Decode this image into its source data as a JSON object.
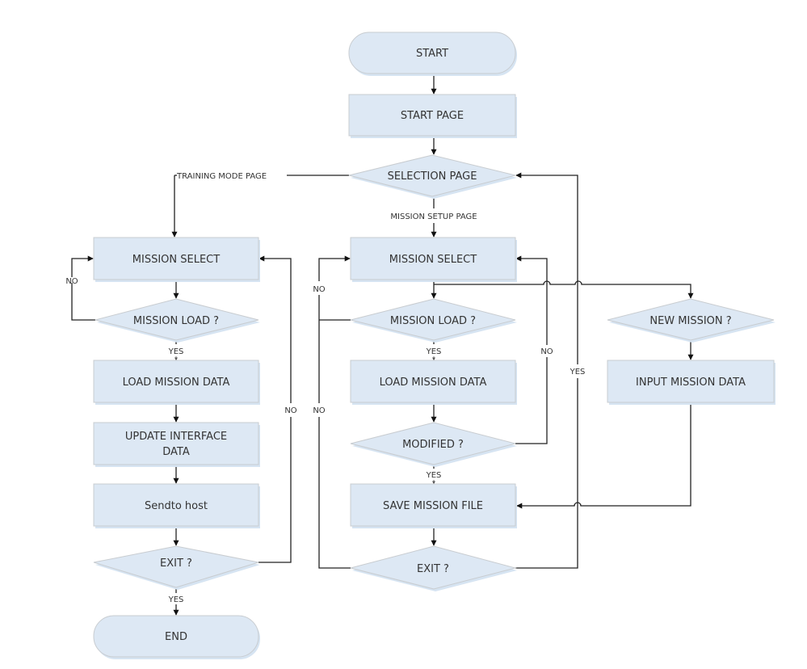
{
  "diagram": {
    "type": "flowchart",
    "colors": {
      "node_fill": "#dde8f4",
      "node_border": "#c8ccd0",
      "edge": "#222222",
      "text": "#333333"
    },
    "nodes": {
      "start": {
        "label": "START",
        "shape": "terminal"
      },
      "start_page": {
        "label": "START PAGE",
        "shape": "process"
      },
      "selection_page": {
        "label": "SELECTION PAGE",
        "shape": "decision"
      },
      "t_mission_select": {
        "label": "MISSION SELECT",
        "shape": "process"
      },
      "t_mission_load": {
        "label": "MISSION LOAD ?",
        "shape": "decision"
      },
      "t_load_data": {
        "label": "LOAD MISSION DATA",
        "shape": "process"
      },
      "t_update_line1": {
        "label": "UPDATE INTERFACE",
        "shape": "process"
      },
      "t_update_line2": {
        "label": "DATA",
        "shape": "process"
      },
      "t_sendto": {
        "label": "Sendto host",
        "shape": "process"
      },
      "t_exit": {
        "label": "EXIT ?",
        "shape": "decision"
      },
      "end": {
        "label": "END",
        "shape": "terminal"
      },
      "s_mission_select": {
        "label": "MISSION SELECT",
        "shape": "process"
      },
      "s_mission_load": {
        "label": "MISSION LOAD ?",
        "shape": "decision"
      },
      "s_load_data": {
        "label": "LOAD MISSION DATA",
        "shape": "process"
      },
      "s_modified": {
        "label": "MODIFIED ?",
        "shape": "decision"
      },
      "s_save": {
        "label": "SAVE MISSION FILE",
        "shape": "process"
      },
      "s_exit": {
        "label": "EXIT ?",
        "shape": "decision"
      },
      "new_mission": {
        "label": "NEW MISSION ?",
        "shape": "decision"
      },
      "input_data": {
        "label": "INPUT MISSION DATA",
        "shape": "process"
      }
    },
    "edge_labels": {
      "training_mode": "TRAINING MODE PAGE",
      "mission_setup": "MISSION SETUP PAGE",
      "t_load_no": "NO",
      "t_load_yes": "YES",
      "t_exit_no": "NO",
      "t_exit_yes": "YES",
      "s_load_no": "NO",
      "s_load_yes": "YES",
      "s_modified_no": "NO",
      "s_modified_yes": "YES",
      "s_exit_no": "NO",
      "s_exit_yes": "YES"
    },
    "edges": [
      {
        "from": "start",
        "to": "start_page"
      },
      {
        "from": "start_page",
        "to": "selection_page"
      },
      {
        "from": "selection_page",
        "to": "t_mission_select",
        "label": "TRAINING MODE PAGE"
      },
      {
        "from": "selection_page",
        "to": "s_mission_select",
        "label": "MISSION SETUP PAGE"
      },
      {
        "from": "t_mission_select",
        "to": "t_mission_load"
      },
      {
        "from": "t_mission_load",
        "to": "t_mission_select",
        "label": "NO"
      },
      {
        "from": "t_mission_load",
        "to": "t_load_data",
        "label": "YES"
      },
      {
        "from": "t_load_data",
        "to": "t_update"
      },
      {
        "from": "t_update",
        "to": "t_sendto"
      },
      {
        "from": "t_sendto",
        "to": "t_exit"
      },
      {
        "from": "t_exit",
        "to": "t_mission_select",
        "label": "NO"
      },
      {
        "from": "t_exit",
        "to": "end",
        "label": "YES"
      },
      {
        "from": "s_mission_select",
        "to": "s_mission_load"
      },
      {
        "from": "s_mission_select",
        "to": "new_mission"
      },
      {
        "from": "s_mission_load",
        "to": "s_mission_select",
        "label": "NO"
      },
      {
        "from": "s_mission_load",
        "to": "s_load_data",
        "label": "YES"
      },
      {
        "from": "s_load_data",
        "to": "s_modified"
      },
      {
        "from": "s_modified",
        "to": "s_mission_select",
        "label": "NO"
      },
      {
        "from": "s_modified",
        "to": "s_save",
        "label": "YES"
      },
      {
        "from": "s_save",
        "to": "s_exit"
      },
      {
        "from": "s_exit",
        "to": "s_mission_select",
        "label": "NO"
      },
      {
        "from": "s_exit",
        "to": "selection_page",
        "label": "YES"
      },
      {
        "from": "new_mission",
        "to": "input_data"
      },
      {
        "from": "input_data",
        "to": "s_save"
      }
    ]
  }
}
